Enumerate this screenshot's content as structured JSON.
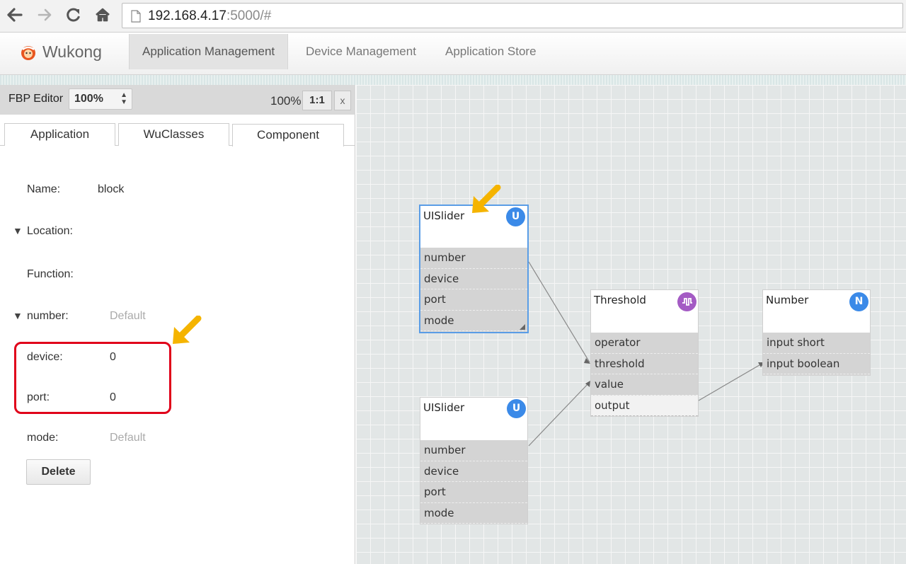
{
  "browser": {
    "url_host": "192.168.4.17",
    "url_rest": ":5000/#"
  },
  "app": {
    "brand": "Wukong",
    "nav": [
      "Application Management",
      "Device Management",
      "Application Store"
    ]
  },
  "toolbar": {
    "label": "FBP Editor",
    "zoom_select": "100%",
    "zoom_display": "100%",
    "reset_zoom": "1:1",
    "close": "x"
  },
  "tabs": [
    "Application",
    "WuClasses",
    "Component"
  ],
  "component": {
    "name_label": "Name:",
    "name_value": "block",
    "location_label": "Location:",
    "function_label": "Function:",
    "number_label": "number:",
    "number_value": "Default",
    "device_label": "device:",
    "device_value": "0",
    "port_label": "port:",
    "port_value": "0",
    "mode_label": "mode:",
    "mode_value": "Default",
    "delete": "Delete"
  },
  "blocks": {
    "slider1": {
      "title": "UISlider",
      "icon": "U",
      "props": [
        "number",
        "device",
        "port",
        "mode"
      ]
    },
    "slider2": {
      "title": "UISlider",
      "icon": "U",
      "props": [
        "number",
        "device",
        "port",
        "mode"
      ]
    },
    "threshold": {
      "title": "Threshold",
      "icon": "threshold-icon",
      "props": [
        "operator",
        "threshold",
        "value",
        "output"
      ]
    },
    "number": {
      "title": "Number",
      "icon": "N",
      "props": [
        "input short",
        "input boolean"
      ]
    }
  },
  "colors": {
    "icon_blue": "#3b8ae8",
    "icon_purple": "#a45bc4",
    "highlight_red": "#e0001a",
    "annotation_arrow": "#f5b400"
  }
}
